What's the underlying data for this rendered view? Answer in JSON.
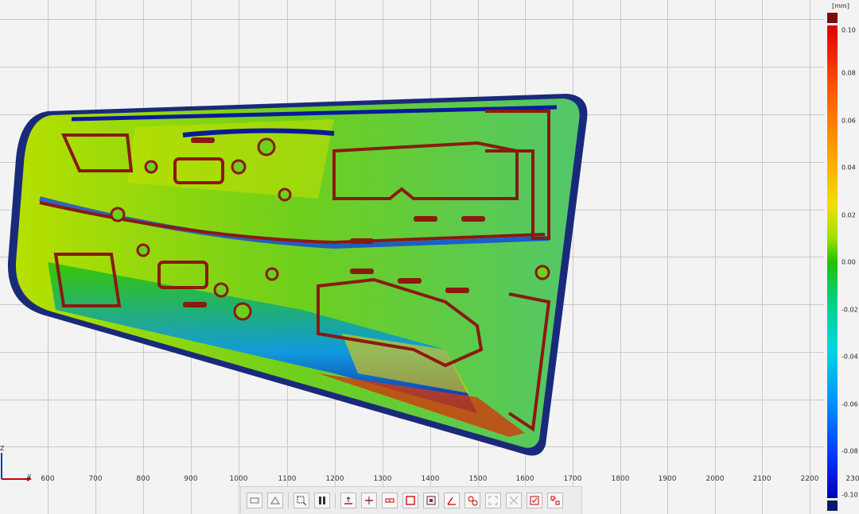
{
  "x_axis": {
    "ticks": [
      "600",
      "700",
      "800",
      "900",
      "1000",
      "1100",
      "1200",
      "1300",
      "1400",
      "1500",
      "1600",
      "1700",
      "1800",
      "1900",
      "2000",
      "2100",
      "2200",
      "230"
    ]
  },
  "axes_indicator": {
    "x_label": "X",
    "z_label": "Z"
  },
  "color_scale": {
    "unit": "[mm]",
    "labels": [
      "0.10",
      "0.08",
      "0.06",
      "0.04",
      "0.02",
      "0.00",
      "-0.02",
      "-0.04",
      "-0.06",
      "-0.08",
      "-0.10"
    ],
    "over_color": "#7a0c0c",
    "under_color": "#0a1a6a",
    "gradient_colors": [
      "#e10000",
      "#ff6000",
      "#ffb000",
      "#f0e000",
      "#a0e000",
      "#22c400",
      "#00d080",
      "#00d8e0",
      "#0090ff",
      "#0030ff",
      "#0000b0"
    ]
  },
  "part": {
    "description": "deviation color map of molded tray part",
    "base_color": "#6ecf1c",
    "feature_color": "#8a1a10",
    "rim_color": "#1a2a7a"
  },
  "toolbar": {
    "buttons": [
      {
        "icon": "view-front-icon"
      },
      {
        "icon": "view-iso-icon"
      },
      {
        "icon": "select-box-icon"
      },
      {
        "icon": "section-icon"
      },
      {
        "icon": "align-up-icon"
      },
      {
        "icon": "align-mid-icon"
      },
      {
        "icon": "measure-icon"
      },
      {
        "icon": "rectangle-icon"
      },
      {
        "icon": "zoom-region-icon"
      },
      {
        "icon": "angle-icon"
      },
      {
        "icon": "circle-link-icon"
      },
      {
        "icon": "fit-icon"
      },
      {
        "icon": "frame-icon"
      },
      {
        "icon": "check-icon"
      },
      {
        "icon": "report-icon"
      }
    ]
  }
}
